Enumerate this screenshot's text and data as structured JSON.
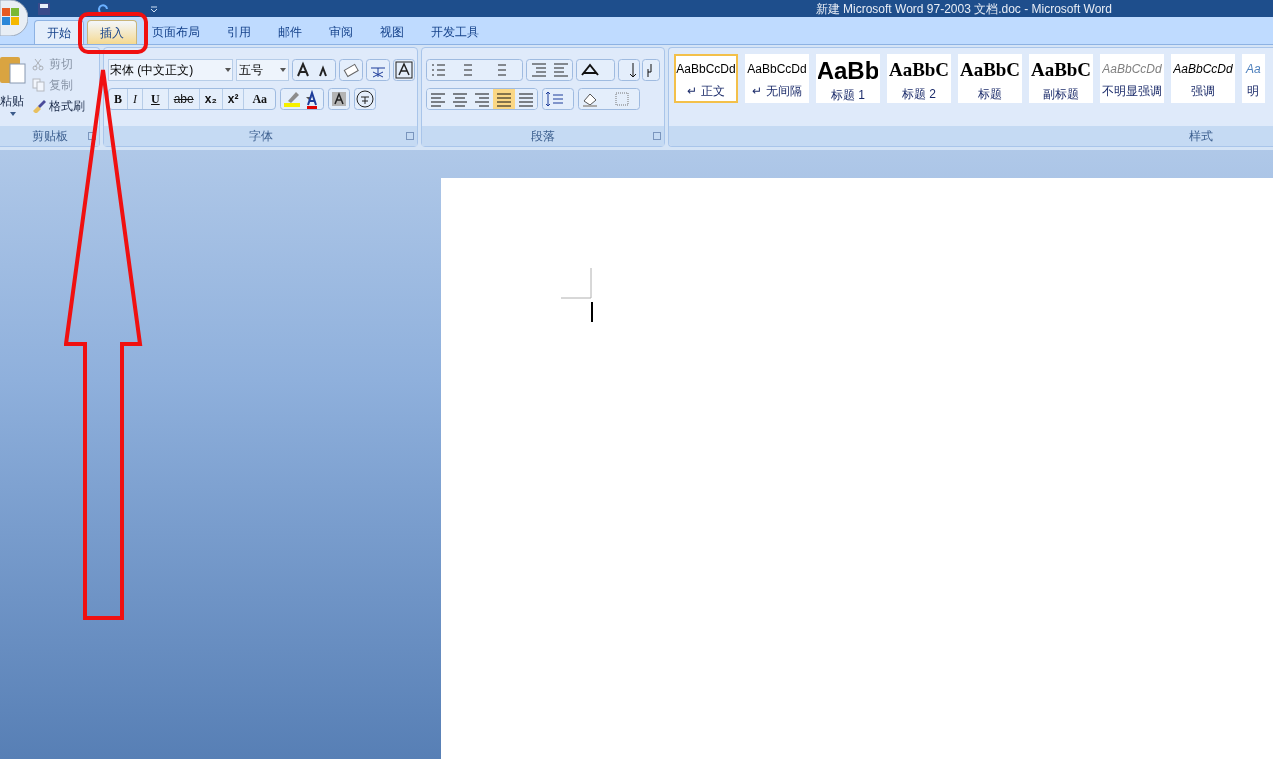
{
  "window": {
    "title": "新建 Microsoft Word 97-2003 文档.doc - Microsoft Word"
  },
  "tabs": [
    {
      "label": "开始",
      "selected": true,
      "hovered": false
    },
    {
      "label": "插入",
      "selected": false,
      "hovered": true
    },
    {
      "label": "页面布局",
      "selected": false,
      "hovered": false
    },
    {
      "label": "引用",
      "selected": false,
      "hovered": false
    },
    {
      "label": "邮件",
      "selected": false,
      "hovered": false
    },
    {
      "label": "审阅",
      "selected": false,
      "hovered": false
    },
    {
      "label": "视图",
      "selected": false,
      "hovered": false
    },
    {
      "label": "开发工具",
      "selected": false,
      "hovered": false
    }
  ],
  "clipboard": {
    "label": "剪贴板",
    "paste": "粘贴",
    "items": [
      {
        "kind": "cut",
        "label": "剪切",
        "disabled": true
      },
      {
        "kind": "copy",
        "label": "复制",
        "disabled": true
      },
      {
        "kind": "painter",
        "label": "格式刷",
        "disabled": false
      }
    ]
  },
  "font": {
    "label": "字体",
    "font_name": "宋体 (中文正文)",
    "font_size": "五号",
    "buttons": [
      {
        "kind": "bold",
        "text": "B"
      },
      {
        "kind": "italic",
        "text": "I"
      },
      {
        "kind": "underline",
        "text": "U"
      },
      {
        "kind": "strike",
        "text": "abe"
      },
      {
        "kind": "sub",
        "text": "x₂"
      },
      {
        "kind": "sup",
        "text": "x²"
      },
      {
        "kind": "case",
        "text": "Aa"
      }
    ]
  },
  "paragraph": {
    "label": "段落",
    "alignments": [
      {
        "kind": "left",
        "selected": false
      },
      {
        "kind": "center",
        "selected": false
      },
      {
        "kind": "right",
        "selected": false
      },
      {
        "kind": "justify",
        "selected": true
      },
      {
        "kind": "distributed",
        "selected": false
      }
    ]
  },
  "styles": {
    "label": "样式",
    "items": [
      {
        "kind": "normal",
        "preview": "AaBbCcDd",
        "name": "↵ 正文",
        "selected": true
      },
      {
        "kind": "normal",
        "preview": "AaBbCcDd",
        "name": "↵ 无间隔",
        "selected": false
      },
      {
        "kind": "heading1",
        "preview": "AaBb",
        "name": "标题 1",
        "selected": false
      },
      {
        "kind": "heading2",
        "preview": "AaBbC",
        "name": "标题 2",
        "selected": false
      },
      {
        "kind": "title",
        "preview": "AaBbC",
        "name": "标题",
        "selected": false
      },
      {
        "kind": "title",
        "preview": "AaBbC",
        "name": "副标题",
        "selected": false
      },
      {
        "kind": "subtle",
        "preview": "AaBbCcDd",
        "name": "不明显强调",
        "selected": false
      },
      {
        "kind": "emphasis",
        "preview": "AaBbCcDd",
        "name": "强调",
        "selected": false
      },
      {
        "kind": "intense",
        "preview": "Aa",
        "name": "明",
        "selected": false
      }
    ]
  }
}
